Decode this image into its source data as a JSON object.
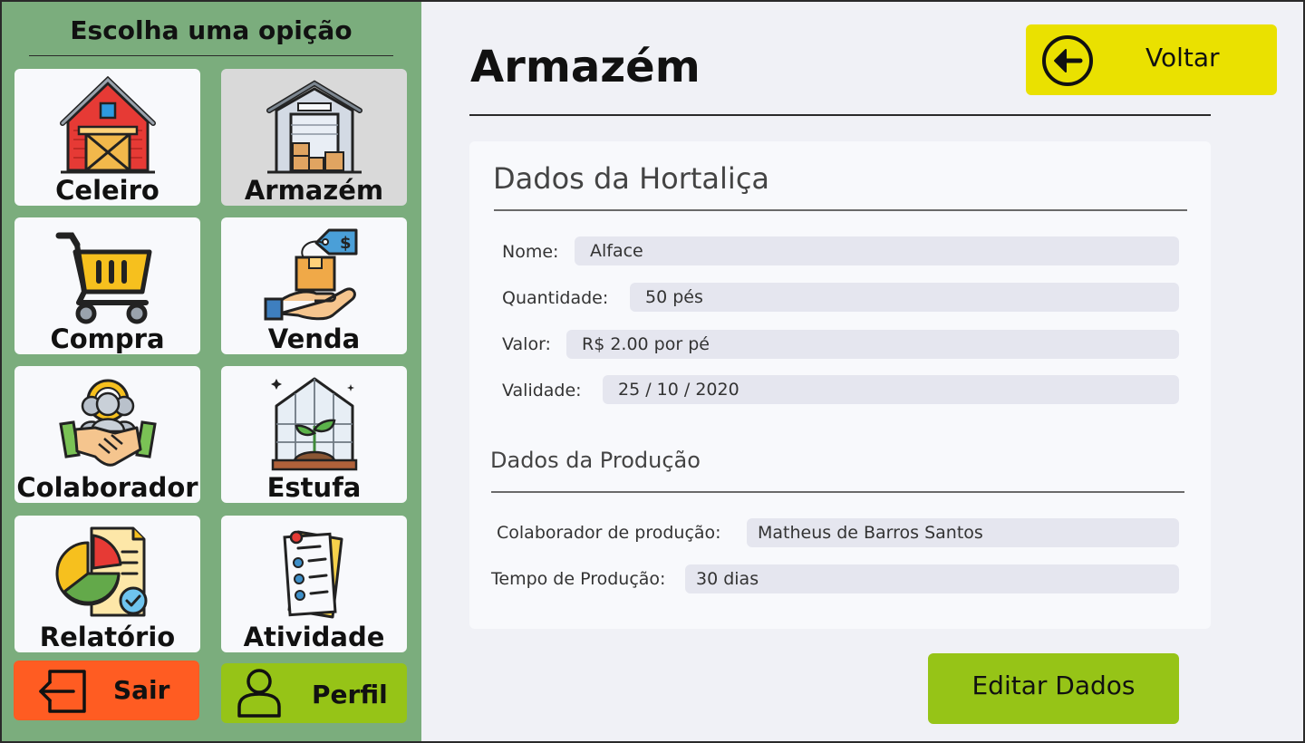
{
  "sidebar": {
    "title": "Escolha uma opição",
    "tiles": [
      {
        "label": "Celeiro",
        "icon": "barn-icon"
      },
      {
        "label": "Armazém",
        "icon": "warehouse-icon"
      },
      {
        "label": "Compra",
        "icon": "shopping-cart-icon"
      },
      {
        "label": "Venda",
        "icon": "sale-hand-icon"
      },
      {
        "label": "Colaborador",
        "icon": "collaborator-icon"
      },
      {
        "label": "Estufa",
        "icon": "greenhouse-icon"
      },
      {
        "label": "Relatório",
        "icon": "report-icon"
      },
      {
        "label": "Atividade",
        "icon": "activity-icon"
      }
    ],
    "logout_label": "Sair",
    "profile_label": "Perfil"
  },
  "header": {
    "title": "Armazém",
    "back_label": "Voltar"
  },
  "card": {
    "title": "Dados da Hortaliça",
    "fields": [
      {
        "label": "Nome:",
        "value": "Alface"
      },
      {
        "label": "Quantidade:",
        "value": "50 pés"
      },
      {
        "label": "Valor:",
        "value": "R$ 2.00 por pé"
      },
      {
        "label": "Validade:",
        "value": "25 / 10 / 2020"
      }
    ],
    "production_title": "Dados da Produção",
    "production_fields": [
      {
        "label": "Colaborador de produção:",
        "value": "Matheus de Barros Santos"
      },
      {
        "label": "Tempo de Produção:",
        "value": "30 dias"
      }
    ]
  },
  "edit_label": "Editar Dados",
  "colors": {
    "sidebar": "#7bad7d",
    "back_button": "#eae100",
    "edit_button": "#96c417",
    "logout_button": "#ff5c22",
    "profile_button": "#96c417"
  }
}
